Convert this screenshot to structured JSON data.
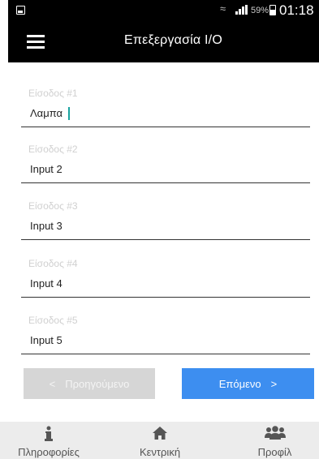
{
  "status_bar": {
    "battery_percent": "59%",
    "time": "01:18"
  },
  "app_bar": {
    "title": "Επεξεργασία I/O"
  },
  "form": {
    "fields": [
      {
        "label": "Είσοδος #1",
        "value": "Λαμπα"
      },
      {
        "label": "Είσοδος #2",
        "value": "Input 2"
      },
      {
        "label": "Είσοδος #3",
        "value": "Input 3"
      },
      {
        "label": "Είσοδος #4",
        "value": "Input 4"
      },
      {
        "label": "Είσοδος #5",
        "value": "Input 5"
      }
    ]
  },
  "buttons": {
    "prev_label": "Προηγούμενο",
    "next_label": "Επόμενο"
  },
  "bottom_nav": {
    "items": [
      {
        "label": "Πληροφορίες",
        "icon": "info-icon"
      },
      {
        "label": "Κεντρική",
        "icon": "home-icon"
      },
      {
        "label": "Προφίλ",
        "icon": "users-icon"
      }
    ]
  },
  "colors": {
    "accent": "#3d8ef0",
    "disabled": "#d6d6d6",
    "cursor": "#19a3a0",
    "bar": "#000000",
    "nav_bg": "#ececec"
  }
}
